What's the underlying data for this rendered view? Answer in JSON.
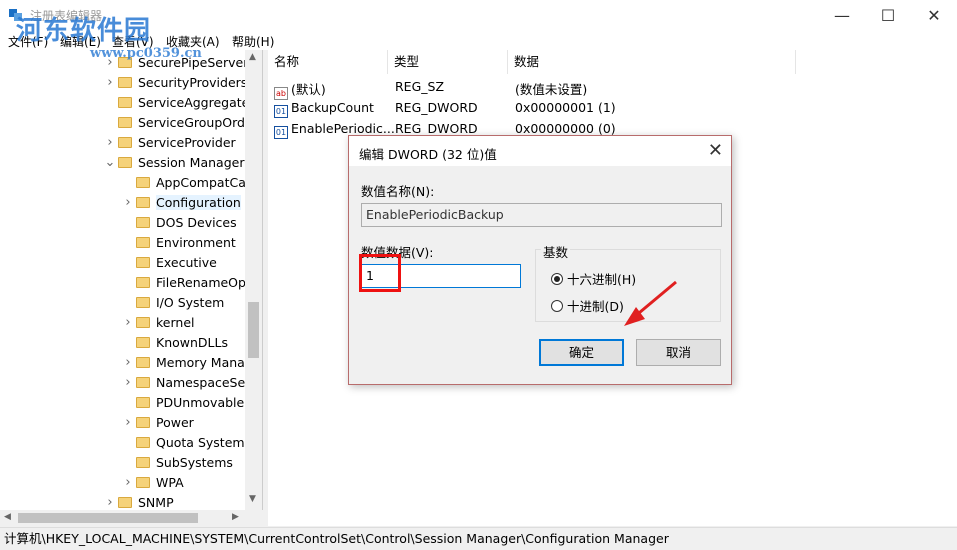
{
  "window": {
    "title": "注册表编辑器",
    "minimize": "—",
    "maximize": "☐",
    "close": "✕"
  },
  "watermark": {
    "text": "河东软件园",
    "url": "www.pc0359.cn"
  },
  "menu": [
    "文件(F)",
    "编辑(E)",
    "查看(V)",
    "收藏夹(A)",
    "帮助(H)"
  ],
  "tree": [
    {
      "label": "SecurePipeServers",
      "indent": 1,
      "caret": ">"
    },
    {
      "label": "SecurityProviders",
      "indent": 1,
      "caret": ">"
    },
    {
      "label": "ServiceAggregate",
      "indent": 1,
      "caret": ""
    },
    {
      "label": "ServiceGroupOrde",
      "indent": 1,
      "caret": ""
    },
    {
      "label": "ServiceProvider",
      "indent": 1,
      "caret": ">"
    },
    {
      "label": "Session Manager",
      "indent": 1,
      "caret": "v"
    },
    {
      "label": "AppCompatCa",
      "indent": 2,
      "caret": ""
    },
    {
      "label": "Configuration",
      "indent": 2,
      "caret": ">",
      "selected": true
    },
    {
      "label": "DOS Devices",
      "indent": 2,
      "caret": ""
    },
    {
      "label": "Environment",
      "indent": 2,
      "caret": ""
    },
    {
      "label": "Executive",
      "indent": 2,
      "caret": ""
    },
    {
      "label": "FileRenameOp",
      "indent": 2,
      "caret": ""
    },
    {
      "label": "I/O System",
      "indent": 2,
      "caret": ""
    },
    {
      "label": "kernel",
      "indent": 2,
      "caret": ">"
    },
    {
      "label": "KnownDLLs",
      "indent": 2,
      "caret": ""
    },
    {
      "label": "Memory Mana",
      "indent": 2,
      "caret": ">"
    },
    {
      "label": "NamespaceSe",
      "indent": 2,
      "caret": ">"
    },
    {
      "label": "PDUnmovableI",
      "indent": 2,
      "caret": ""
    },
    {
      "label": "Power",
      "indent": 2,
      "caret": ">"
    },
    {
      "label": "Quota System",
      "indent": 2,
      "caret": ""
    },
    {
      "label": "SubSystems",
      "indent": 2,
      "caret": ""
    },
    {
      "label": "WPA",
      "indent": 2,
      "caret": ">"
    },
    {
      "label": "SNMP",
      "indent": 1,
      "caret": ">"
    }
  ],
  "list": {
    "columns": [
      "名称",
      "类型",
      "数据"
    ],
    "rows": [
      {
        "icon": "ab",
        "name": "(默认)",
        "type": "REG_SZ",
        "data": "(数值未设置)"
      },
      {
        "icon": "01",
        "name": "BackupCount",
        "type": "REG_DWORD",
        "data": "0x00000001 (1)"
      },
      {
        "icon": "01",
        "name": "EnablePeriodic...",
        "type": "REG_DWORD",
        "data": "0x00000000 (0)"
      }
    ]
  },
  "status": "计算机\\HKEY_LOCAL_MACHINE\\SYSTEM\\CurrentControlSet\\Control\\Session Manager\\Configuration Manager",
  "dialog": {
    "title": "编辑 DWORD (32 位)值",
    "name_label": "数值名称(N):",
    "name_value": "EnablePeriodicBackup",
    "data_label": "数值数据(V):",
    "data_value": "1",
    "base_label": "基数",
    "hex_label": "十六进制(H)",
    "dec_label": "十进制(D)",
    "selected_base": "hex",
    "ok": "确定",
    "cancel": "取消"
  },
  "colors": {
    "highlight_box": "#ee1111",
    "arrow": "#e02020",
    "default_button_border": "#0078d7"
  }
}
